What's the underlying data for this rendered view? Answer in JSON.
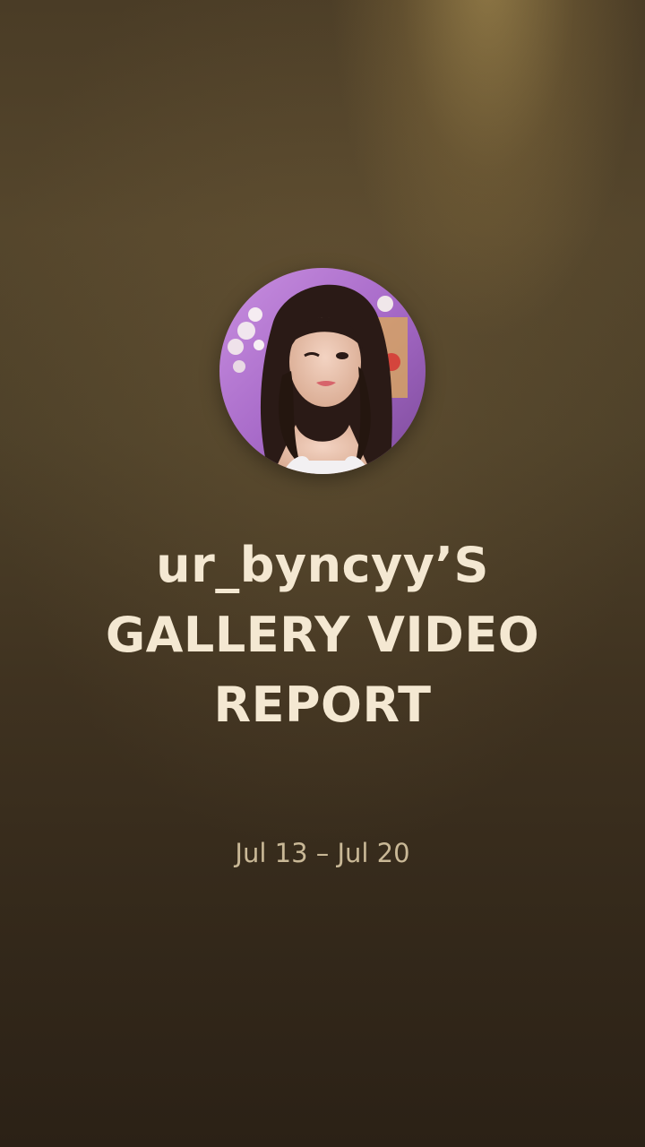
{
  "report": {
    "title_line_1": "ur_byncyy’S",
    "title_line_2": "GALLERY VIDEO",
    "title_line_3": "REPORT",
    "date_range": "Jul 13 – Jul 20"
  },
  "colors": {
    "background_top": "#55462c",
    "background_bottom": "#2b2116",
    "title_text": "#f4e8d2",
    "date_text": "#c9b896",
    "spotlight": "#c9aa60"
  }
}
